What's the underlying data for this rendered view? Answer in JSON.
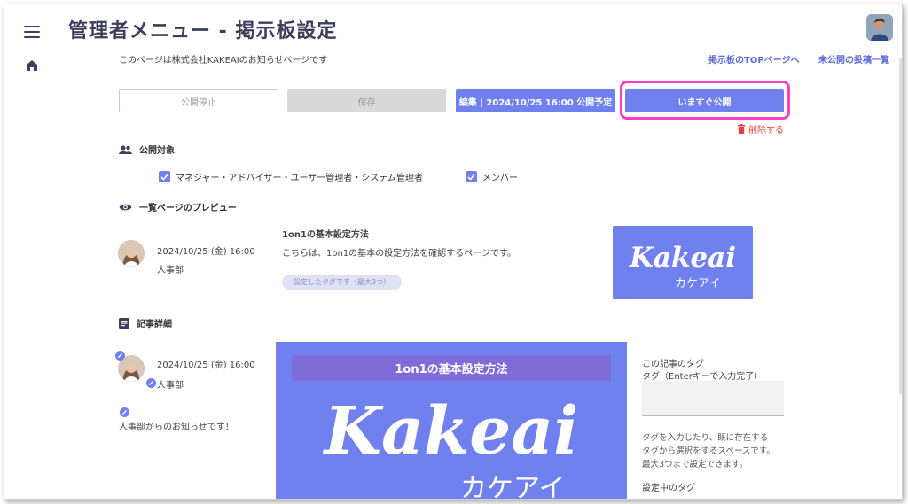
{
  "header": {
    "title": "管理者メニュー - 掲示板設定",
    "notice": "このページは株式会社KAKEAIのお知らせページです",
    "links": {
      "top_page": "掲示板のTOPページへ",
      "unpublished": "未公開の投稿一覧"
    }
  },
  "toolbar": {
    "stop_label": "公開停止",
    "save_label": "保存",
    "edit_label": "編集 | 2024/10/25 16:00 公開予定",
    "publish_label": "いますぐ公開",
    "delete_label": "削除する"
  },
  "audience": {
    "title": "公開対象",
    "options": [
      {
        "label": "マネジャー・アドバイザー・ユーザー管理者・システム管理者",
        "checked": true
      },
      {
        "label": "メンバー",
        "checked": true
      }
    ]
  },
  "preview": {
    "title": "一覧ページのプレビュー",
    "date": "2024/10/25 (金) 16:00",
    "department": "人事部",
    "post_title": "1on1の基本設定方法",
    "post_desc": "こちらは、1on1の基本の設定方法を確認するページです。",
    "tag_placeholder": "設定したタグです（最大3つ）",
    "thumb_logo": "Kakeai",
    "thumb_sub": "カケアイ"
  },
  "detail": {
    "title": "記事詳細",
    "date": "2024/10/25 (金) 16:00",
    "department": "人事部",
    "message": "人事部からのお知らせです！",
    "hero_title": "1on1の基本設定方法",
    "hero_logo": "Kakeai",
    "hero_sub": "カケアイ"
  },
  "tags_panel": {
    "heading": "この記事のタグ",
    "label": "タグ（Enterキーで入力完了）",
    "help": [
      "タグを入力したり、既に存在する",
      "タグから選択をするスペースです。",
      "最大3つまで設定できます。"
    ],
    "current": "設定中のタグ"
  },
  "colors": {
    "accent": "#7080ee",
    "title": "#3b3f5c",
    "highlight": "#ff3ec8",
    "danger": "#e84040"
  }
}
